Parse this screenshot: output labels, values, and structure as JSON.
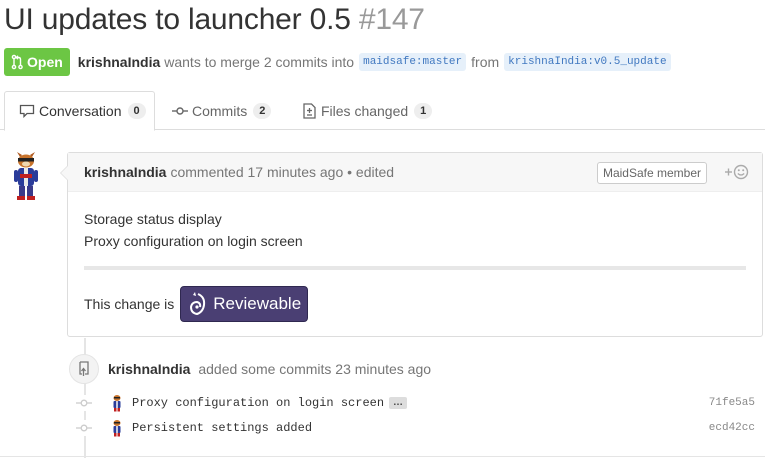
{
  "pr": {
    "title": "UI updates to launcher 0.5",
    "number": "#147",
    "state_label": "Open",
    "author": "krishnaIndia",
    "summary": "wants to merge 2 commits into",
    "base_branch": "maidsafe:master",
    "from_word": "from",
    "head_branch": "krishnaIndia:v0.5_update"
  },
  "tabs": [
    {
      "label": "Conversation",
      "count": "0",
      "icon": "comment-icon",
      "selected": true
    },
    {
      "label": "Commits",
      "count": "2",
      "icon": "git-commit-icon",
      "selected": false
    },
    {
      "label": "Files changed",
      "count": "1",
      "icon": "file-diff-icon",
      "selected": false
    }
  ],
  "comment": {
    "author": "krishnaIndia",
    "meta": "commented 17 minutes ago • edited",
    "role_label": "MaidSafe member",
    "reaction_icon": "add-reaction-icon",
    "lines": [
      "Storage status display",
      "Proxy configuration on login screen"
    ],
    "reviewable_prefix": "This change is",
    "reviewable_label": "Reviewable"
  },
  "event": {
    "author": "krishnaIndia",
    "text": "added some commits 23 minutes ago",
    "icon": "repo-push-icon"
  },
  "commits": [
    {
      "message": "Proxy configuration on login screen",
      "ellipsis": "…",
      "sha": "71fe5a5"
    },
    {
      "message": "Persistent settings added",
      "sha": "ecd42cc"
    }
  ],
  "colors": {
    "open_green": "#6cc644",
    "branch_blue": "#4078c0",
    "reviewable_purple": "#4a3f73"
  }
}
